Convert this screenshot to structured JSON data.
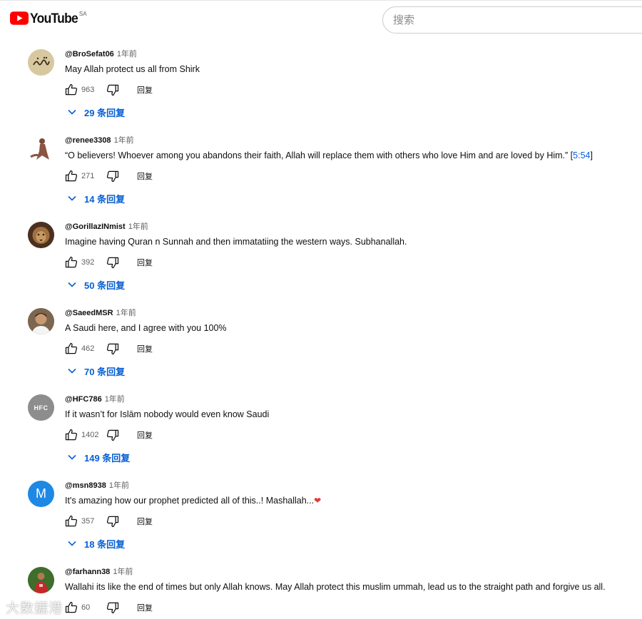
{
  "header": {
    "logo_text": "YouTube",
    "region": "SA",
    "search_placeholder": "搜索"
  },
  "comments": [
    {
      "author": "@BroSefat06",
      "time": "1年前",
      "text": "May Allah protect us all from Shirk",
      "likes": "963",
      "reply_label": "回复",
      "replies": "29 条回复",
      "avatar": "calligraphy"
    },
    {
      "author": "@renee3308",
      "time": "1年前",
      "text": "“O believers! Whoever among you abandons their faith, Allah will replace them with others who love Him and are loved by Him.” [",
      "timestamp": "5:54",
      "text_after": "]",
      "likes": "271",
      "reply_label": "回复",
      "replies": "14 条回复",
      "avatar": "figure"
    },
    {
      "author": "@GorillazINmist",
      "time": "1年前",
      "text": "Imagine having Quran n Sunnah and then immatatiing the western ways. Subhanallah.",
      "likes": "392",
      "reply_label": "回复",
      "replies": "50 条回复",
      "avatar": "lion"
    },
    {
      "author": "@SaeedMSR",
      "time": "1年前",
      "text": "A Saudi here, and I agree with you 100%",
      "likes": "462",
      "reply_label": "回复",
      "replies": "70 条回复",
      "avatar": "person"
    },
    {
      "author": "@HFC786",
      "time": "1年前",
      "text": "If it wasn’t for Islām nobody would even know Saudi",
      "likes": "1402",
      "reply_label": "回复",
      "replies": "149 条回复",
      "avatar": "hfc",
      "avatar_text": "HFC"
    },
    {
      "author": "@msn8938",
      "time": "1年前",
      "text": "It's amazing how our prophet predicted all of this..! Mashallah...",
      "emoji": "❤",
      "likes": "357",
      "reply_label": "回复",
      "replies": "18 条回复",
      "avatar": "letter",
      "avatar_text": "M"
    },
    {
      "author": "@farhann38",
      "time": "1年前",
      "text": "Wallahi its like the end of times but only Allah knows. May Allah protect this muslim ummah, lead us to the straight path and forgive us all.",
      "likes": "60",
      "reply_label": "回复",
      "avatar": "football"
    }
  ],
  "watermark": "大数据港",
  "colors": {
    "brand": "#ff0000",
    "link": "#065fd4",
    "meta": "#606060"
  }
}
